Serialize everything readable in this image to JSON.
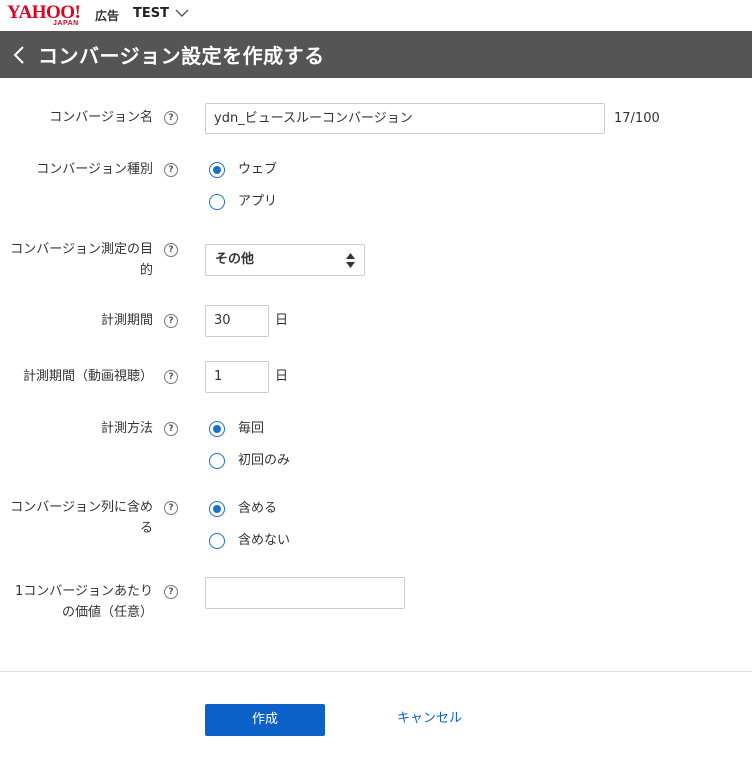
{
  "topbar": {
    "logo_text": "YAHOO!",
    "logo_sub": "JAPAN",
    "service": "広告",
    "account": "TEST"
  },
  "header": {
    "title": "コンバージョン設定を作成する"
  },
  "form": {
    "conversion_name": {
      "label": "コンバージョン名",
      "value": "ydn_ビュースルーコンバージョン",
      "counter": "17/100"
    },
    "conversion_type": {
      "label": "コンバージョン種別",
      "options": [
        "ウェブ",
        "アプリ"
      ],
      "selected": "ウェブ"
    },
    "purpose": {
      "label_line1": "コンバージョン測定の目",
      "label_line2": "的",
      "value": "その他"
    },
    "period": {
      "label": "計測期間",
      "value": "30",
      "unit": "日"
    },
    "period_video": {
      "label": "計測期間（動画視聴）",
      "value": "1",
      "unit": "日"
    },
    "method": {
      "label": "計測方法",
      "options": [
        "毎回",
        "初回のみ"
      ],
      "selected": "毎回"
    },
    "include_column": {
      "label_line1": "コンバージョン列に含め",
      "label_line2": "る",
      "options": [
        "含める",
        "含めない"
      ],
      "selected": "含める"
    },
    "value_per_conversion": {
      "label_line1": "1コンバージョンあたり",
      "label_line2": "の価値（任意）",
      "value": ""
    }
  },
  "actions": {
    "create": "作成",
    "cancel": "キャンセル"
  },
  "help_glyph": "?",
  "colors": {
    "header_bg": "#555555",
    "accent": "#0c61c9",
    "logo_red": "#e1001e"
  }
}
